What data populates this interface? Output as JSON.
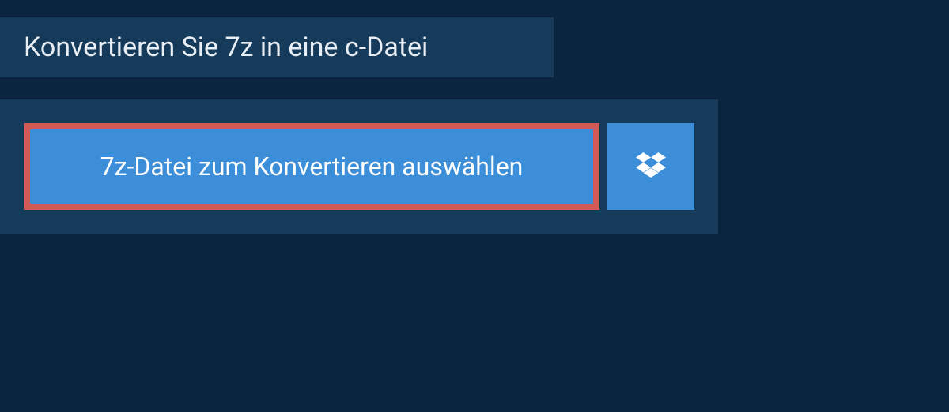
{
  "header": {
    "title": "Konvertieren Sie 7z in eine c-Datei"
  },
  "actions": {
    "select_file_label": "7z-Datei zum Konvertieren auswählen"
  },
  "colors": {
    "background": "#0a2540",
    "panel": "#163a5a",
    "button": "#3d8ed8",
    "highlight_border": "#d25a56",
    "text": "#ffffff"
  },
  "icons": {
    "dropbox": "dropbox-icon"
  }
}
